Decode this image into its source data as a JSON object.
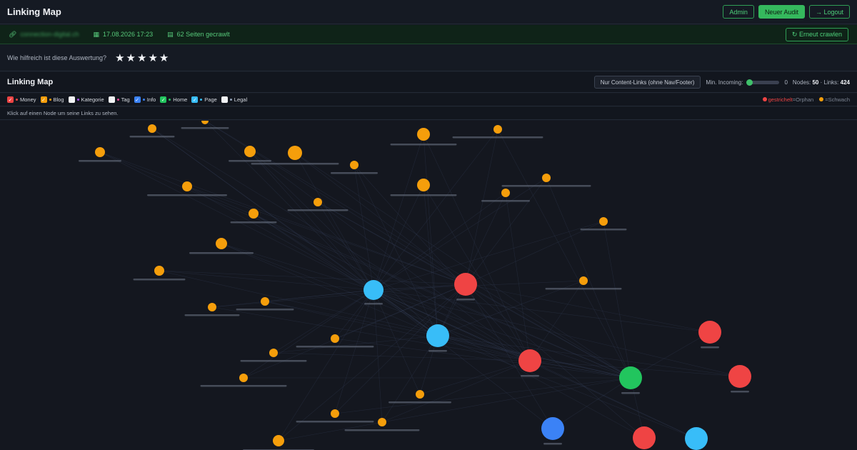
{
  "app": {
    "title": "Linking Map"
  },
  "topbar": {
    "admin_label": "Admin",
    "new_audit_label": "Neuer Audit",
    "logout_label": "→ Logout"
  },
  "info": {
    "domain": "connection-digital.ch",
    "date": "17.08.2026 17:23",
    "pages": "62 Seiten gecrawlt",
    "recrawl_label": "↻ Erneut crawlen"
  },
  "rating": {
    "question": "Wie hilfreich ist diese Auswertung?",
    "stars": [
      "★",
      "★",
      "★",
      "★",
      "★"
    ]
  },
  "map": {
    "title": "Linking Map",
    "content_links_label": "Nur Content-Links (ohne Nav/Footer)",
    "min_incoming_label": "Min. Incoming:",
    "min_incoming_value": "0",
    "nodes_label": "Nodes:",
    "nodes_value": "50",
    "links_label": "Links:",
    "links_value": "424",
    "hint": "Klick auf einen Node um seine Links zu sehen."
  },
  "filters": [
    {
      "label": "Money",
      "color": "#ef4444",
      "checked": true
    },
    {
      "label": "Blog",
      "color": "#f59e0b",
      "checked": true
    },
    {
      "label": "Kategorie",
      "color": "#a855f7",
      "checked": false
    },
    {
      "label": "Tag",
      "color": "#ec4899",
      "checked": false
    },
    {
      "label": "Info",
      "color": "#3b82f6",
      "checked": true
    },
    {
      "label": "Home",
      "color": "#22c55e",
      "checked": true
    },
    {
      "label": "Page",
      "color": "#38bdf8",
      "checked": true
    },
    {
      "label": "Legal",
      "color": "#94a3b8",
      "checked": false
    }
  ],
  "legend": {
    "orphan_prefix": "gestrichelt",
    "orphan_suffix": "=Orphan",
    "weak": "=Schwach"
  },
  "colors": {
    "money": "#ef4444",
    "blog": "#f59e0b",
    "info": "#3b82f6",
    "home": "#22c55e",
    "page": "#38bdf8"
  }
}
